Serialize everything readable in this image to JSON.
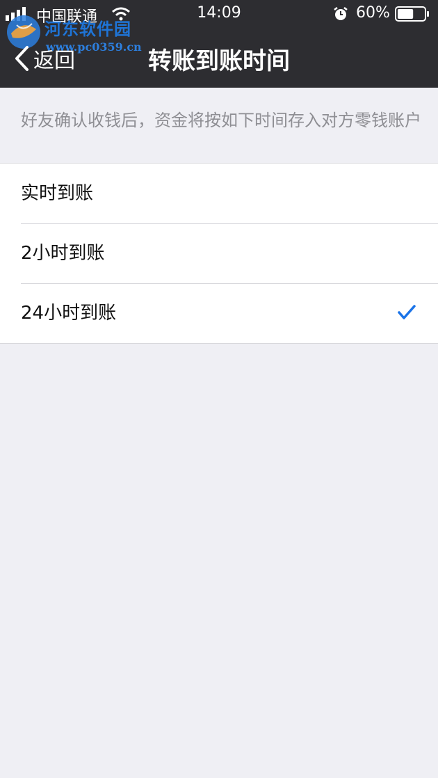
{
  "status_bar": {
    "carrier": "中国联通",
    "time": "14:09",
    "battery_percent": "60%",
    "battery_level": 0.6,
    "icons": [
      "signal-icon",
      "wifi-icon",
      "alarm-icon",
      "battery-icon"
    ]
  },
  "watermark": {
    "title": "河东软件园",
    "url": "www.pc0359.cn"
  },
  "nav": {
    "back_label": "返回",
    "title": "转账到账时间"
  },
  "description": "好友确认收钱后，资金将按如下时间存入对方零钱账户",
  "options": [
    {
      "label": "实时到账",
      "selected": false
    },
    {
      "label": "2小时到账",
      "selected": false
    },
    {
      "label": "24小时到账",
      "selected": true
    }
  ],
  "colors": {
    "nav_background": "#2d2d31",
    "page_background": "#efeff4",
    "check_accent": "#1a73e8",
    "secondary_text": "#8e8e93"
  }
}
